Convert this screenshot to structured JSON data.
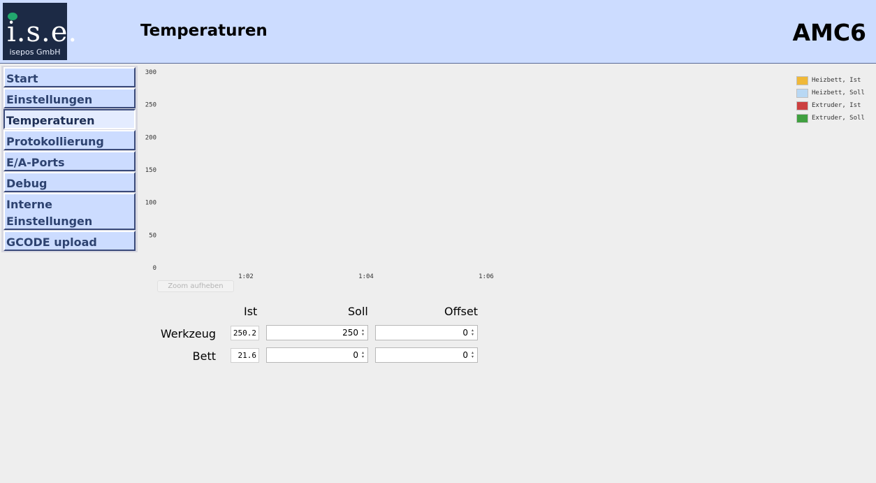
{
  "header": {
    "logo_mark": "i.s.e.",
    "logo_company": "isepos GmbH",
    "page_title": "Temperaturen",
    "device": "AMC6"
  },
  "sidebar": {
    "items": [
      {
        "label": "Start",
        "active": false
      },
      {
        "label": "Einstellungen",
        "active": false
      },
      {
        "label": "Temperaturen",
        "active": true
      },
      {
        "label": "Protokollierung",
        "active": false
      },
      {
        "label": "E/A-Ports",
        "active": false
      },
      {
        "label": "Debug",
        "active": false
      },
      {
        "label": "Interne Einstellungen",
        "active": false
      },
      {
        "label": "GCODE upload",
        "active": false
      }
    ]
  },
  "chart_data": {
    "type": "line",
    "ylim": [
      0,
      300
    ],
    "y_ticks": [
      "300",
      "250",
      "200",
      "150",
      "100",
      "50",
      "0"
    ],
    "x_ticks": [
      "1:02",
      "1:04",
      "1:06"
    ],
    "grid": false,
    "legend_position": "top-right",
    "series": [
      {
        "name": "Heizbett, Ist",
        "color": "#f0b838",
        "values": []
      },
      {
        "name": "Heizbett, Soll",
        "color": "#b8d8f4",
        "values": []
      },
      {
        "name": "Extruder, Ist",
        "color": "#cc4040",
        "values": []
      },
      {
        "name": "Extruder, Soll",
        "color": "#40a040",
        "values": []
      }
    ]
  },
  "zoom_button": "Zoom aufheben",
  "table": {
    "headers": {
      "ist": "Ist",
      "soll": "Soll",
      "offset": "Offset"
    },
    "rows": [
      {
        "label": "Werkzeug",
        "ist": "250.2",
        "soll": "250",
        "offset": "0"
      },
      {
        "label": "Bett",
        "ist": "21.6",
        "soll": "0",
        "offset": "0"
      }
    ]
  }
}
